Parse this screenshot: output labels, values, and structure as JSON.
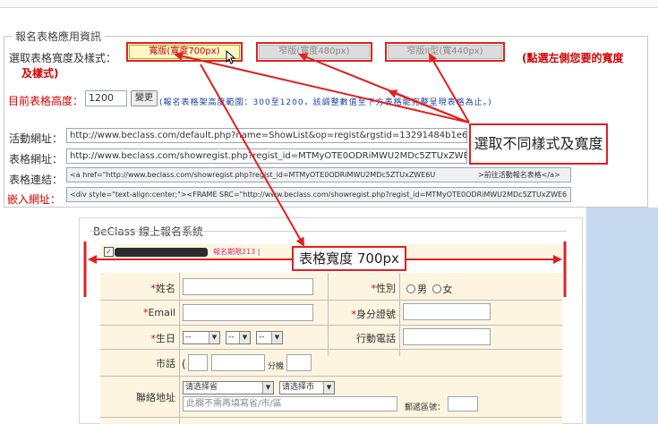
{
  "settings": {
    "legend": "報名表格應用資訊",
    "select_width_label": "選取表格寬度及樣式：",
    "tabs": [
      {
        "label": "寬版(寬度700px)",
        "state": "active"
      },
      {
        "label": "窄版(寬度480px)",
        "state": "disabled"
      },
      {
        "label": "窄版II型(寬440px)",
        "state": "disabled"
      }
    ],
    "hint_red_line1": "(點選左側您要的寬度",
    "hint_red_line2": "及樣式)",
    "height_label": "目前表格高度：",
    "height_value": "1200",
    "change_button": "變更",
    "height_note": "(報名表格架高度範圍：300至1200，該調整數值至下方表格能完整呈現表格為止。)",
    "rows": [
      {
        "label": "活動網址：",
        "value": "http://www.beclass.com/default.php?name=ShowList&op=regist&rgstid=13291484b1e60"
      },
      {
        "label": "表格網址：",
        "value": "http://www.beclass.com/showregist.php?regist_id=MTMyOTE0ODRiMWU2MDc5ZTUxZWE6"
      },
      {
        "label": "表格連結：",
        "value": "<a href=\"http://www.beclass.com/showregist.php?regist_id=MTMyOTE0ODRiMWU2MDc5ZTUxZWE6U",
        "suffix": ">前往活動報名表格</a>"
      },
      {
        "label": "嵌入網址：",
        "value": "<div style=\"text-align:center;\"><FRAME SRC=\"http://www.beclass.com/showregist.php?regist_id=MTMyOTE0ODRiMWU2MDc5ZTUxZWE6"
      }
    ]
  },
  "callouts": {
    "select_style": "選取不同樣式及寬度",
    "table_width": "表格寬度 700px"
  },
  "preview": {
    "title": "BeClass 線上報名系統",
    "deadline": "報名期限213 |",
    "fields": {
      "name": "姓名",
      "gender": "性別",
      "male": "男",
      "female": "女",
      "email": "Email",
      "id_number": "身分證號",
      "birthday": "生日",
      "mobile": "行動電話",
      "phone": "市話",
      "ext": "分機",
      "address": "聯絡地址",
      "select_province": "请选择省",
      "select_city": "请选择市",
      "address_placeholder": "此欄不需再填寫省/市/區",
      "zipcode": "郵遞區號："
    },
    "birthday_selects": [
      "--",
      "--",
      "--"
    ]
  },
  "colors": {
    "accent_red": "#e02020",
    "highlight_yellow": "#fff7c8",
    "note_blue": "#1b3e9e",
    "form_bg": "#fdf5e0"
  }
}
